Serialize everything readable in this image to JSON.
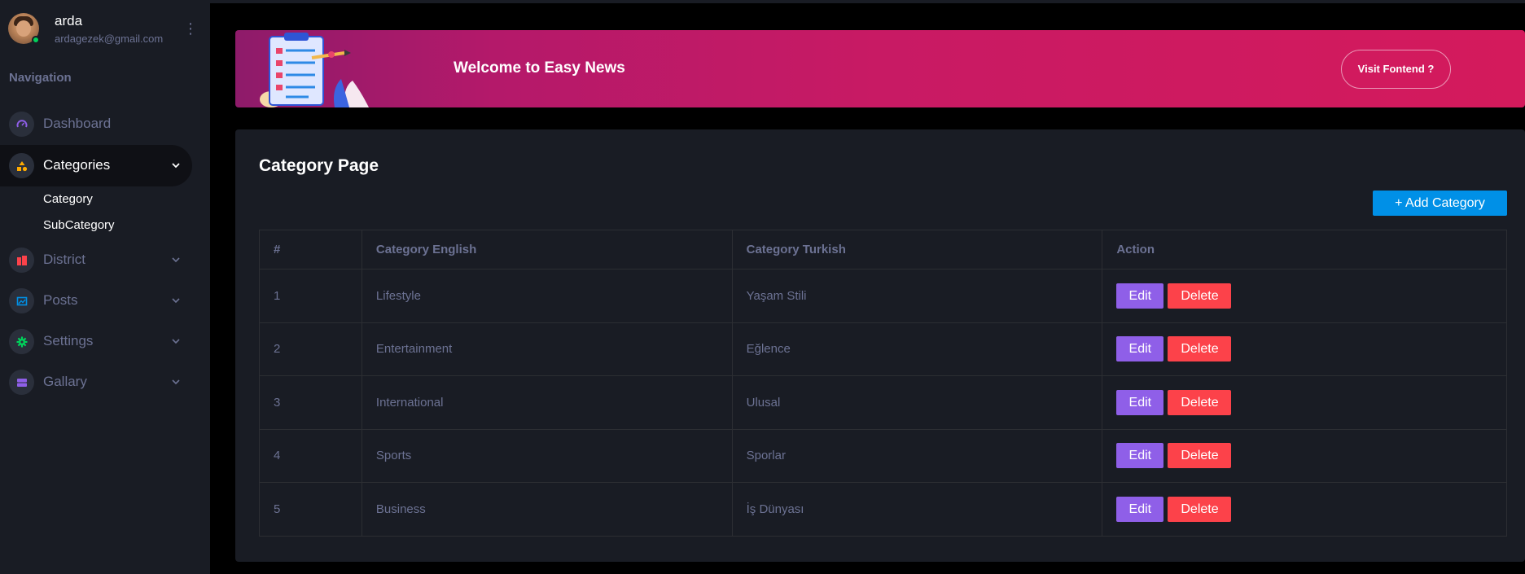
{
  "profile": {
    "name": "arda",
    "email": "ardagezek@gmail.com",
    "avatar_icon": "user-avatar",
    "menu_icon": "more-vertical-icon"
  },
  "sidebar": {
    "heading": "Navigation",
    "items": [
      {
        "label": "Dashboard",
        "icon": "speedometer-icon",
        "icon_color": "#8f5fe8",
        "chevron": ""
      },
      {
        "label": "Categories",
        "icon": "shapes-icon",
        "icon_color": "#ffab00",
        "chevron": "⌄",
        "active": true,
        "subitems": [
          "Category",
          "SubCategory"
        ]
      },
      {
        "label": "District",
        "icon": "building-icon",
        "icon_color": "#fc424a",
        "chevron": "⌄"
      },
      {
        "label": "Posts",
        "icon": "image-icon",
        "icon_color": "#0090e7",
        "chevron": "⌄"
      },
      {
        "label": "Settings",
        "icon": "gear-icon",
        "icon_color": "#00d25b",
        "chevron": "⌄"
      },
      {
        "label": "Gallary",
        "icon": "gallery-icon",
        "icon_color": "#8f5fe8",
        "chevron": "⌄"
      }
    ]
  },
  "banner": {
    "title": "Welcome to Easy News",
    "button_label": "Visit Fontend ?",
    "illustration": "clipboard-checklist-illustration"
  },
  "card": {
    "title": "Category Page",
    "add_button_label": "+ Add Category"
  },
  "table": {
    "headers": [
      "#",
      "Category English",
      "Category Turkish",
      "Action"
    ],
    "rows": [
      {
        "num": "1",
        "en": "Lifestyle",
        "tr": "Yaşam Stili"
      },
      {
        "num": "2",
        "en": "Entertainment",
        "tr": "Eğlence"
      },
      {
        "num": "3",
        "en": "International",
        "tr": "Ulusal"
      },
      {
        "num": "4",
        "en": "Sports",
        "tr": "Sporlar"
      },
      {
        "num": "5",
        "en": "Business",
        "tr": "İş Dünyası"
      }
    ],
    "edit_label": "Edit",
    "delete_label": "Delete"
  },
  "colors": {
    "sidebar_bg": "#191c24",
    "page_bg": "#000000",
    "edit": "#8f5fe8",
    "delete": "#fc424a",
    "primary": "#0090e7",
    "banner_start": "#8e1b6a",
    "banner_end": "#d41a5c"
  }
}
